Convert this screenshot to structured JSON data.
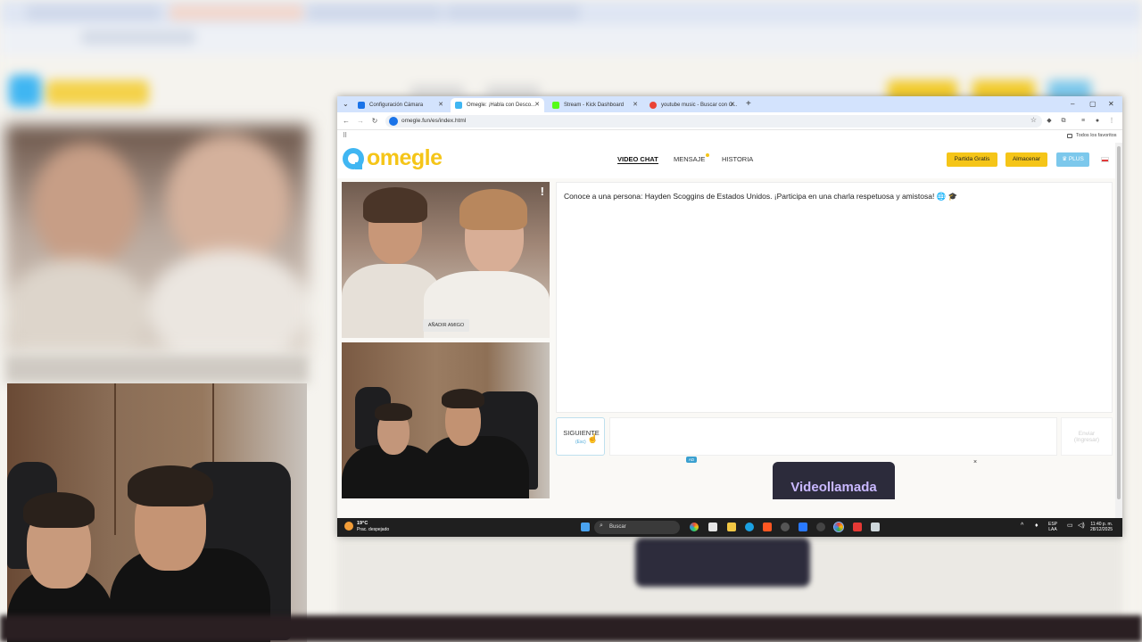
{
  "browser": {
    "tabs": [
      {
        "label": "Configuración Cámara",
        "color": "#1a73e8"
      },
      {
        "label": "Omegle: ¡Habla con Desco...",
        "color": "#40b6f2"
      },
      {
        "label": "Stream - Kick Dashboard",
        "color": "#53fc18"
      },
      {
        "label": "youtube music - Buscar con G...",
        "color": "#ea4335"
      }
    ],
    "new_tab": "+",
    "url": "omegle.fun/es/index.html",
    "bookmarks_label": "Todos los favoritos"
  },
  "site": {
    "logo": "omegle",
    "logo_color": "#f5c518",
    "nav": [
      {
        "label": "VIDEO CHAT"
      },
      {
        "label": "MENSAJE"
      },
      {
        "label": "HISTORIA"
      }
    ],
    "buttons": {
      "free_game": "Partida Gratis",
      "store": "Almacenar",
      "plus": "♛ PLUS"
    },
    "accent_colors": {
      "yellow": "#f5c518",
      "blue": "#7cc8ec"
    },
    "add_friend": "AÑADIR AMIGO",
    "chat_message": "Conoce a una persona: Hayden Scoggins de Estados Unidos. ¡Participa en una charla respetuosa y amistosa! 🌐 🎓",
    "next_button": "SIGUIENTE",
    "next_sub": "(Esc)",
    "send_button": "Enviar\n(Ingresar)",
    "ad_label": "AD",
    "ad_close": "×",
    "video_call": "Videollamada"
  },
  "taskbar": {
    "temperature": "19°C",
    "weather": "Prac. despejado",
    "search": "Buscar",
    "language": "ESP",
    "language2": "LAA",
    "time": "11:40 p. m.",
    "date": "28/12/2025"
  }
}
